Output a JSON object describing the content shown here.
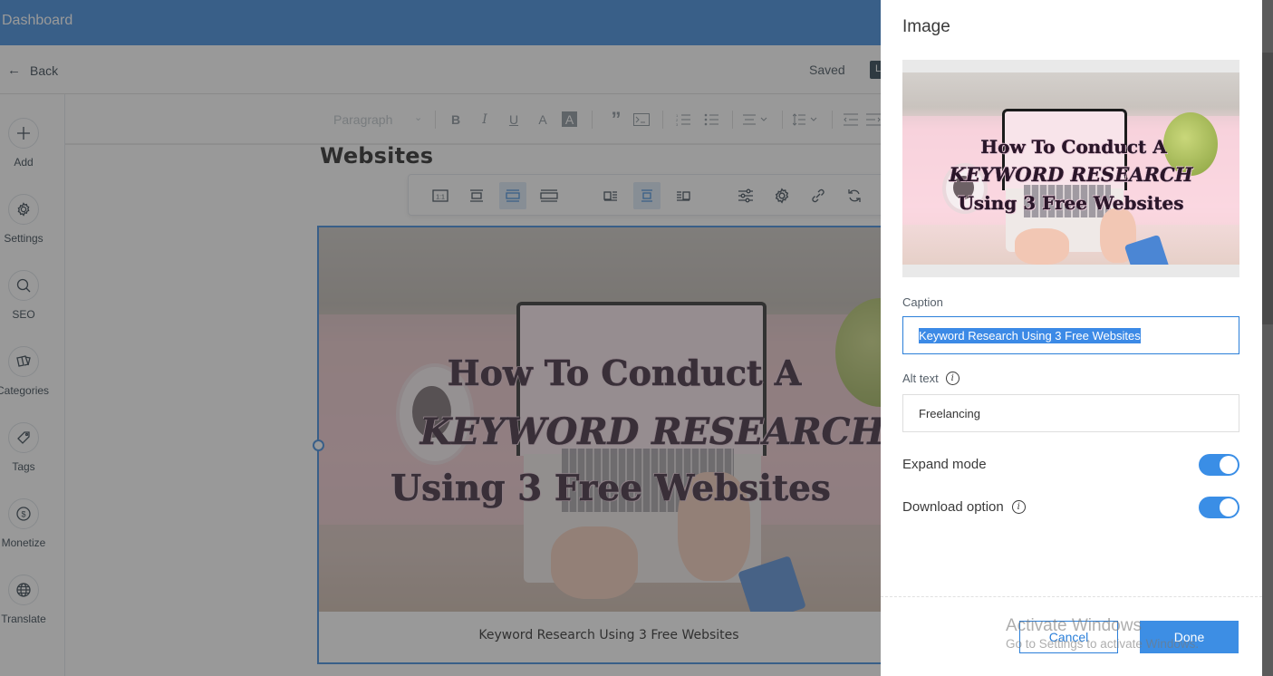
{
  "topbar": {
    "title": "Dashboard"
  },
  "subbar": {
    "back_label": "Back",
    "status": "Saved",
    "publish_stub": "L"
  },
  "sidebar": {
    "items": [
      {
        "label": "Add",
        "icon": "plus-icon"
      },
      {
        "label": "Settings",
        "icon": "gear-icon"
      },
      {
        "label": "SEO",
        "icon": "search-icon"
      },
      {
        "label": "Categories",
        "icon": "cards-icon"
      },
      {
        "label": "Tags",
        "icon": "tag-icon"
      },
      {
        "label": "Monetize",
        "icon": "dollar-icon"
      },
      {
        "label": "Translate",
        "icon": "globe-icon"
      }
    ]
  },
  "format_toolbar": {
    "paragraph_select": "Paragraph",
    "buttons": [
      "bold",
      "italic",
      "underline",
      "text-color",
      "highlight",
      "quote",
      "code-block",
      "numbered-list",
      "bulleted-list",
      "align",
      "line-spacing",
      "indent-decrease",
      "indent-increase"
    ],
    "labels": {
      "bold": "B",
      "italic": "I",
      "underline": "U",
      "quote": "”",
      "chevron": "⌄"
    }
  },
  "editor": {
    "heading": "Websites",
    "image_caption": "Keyword Research Using 3 Free Websites",
    "image_text": {
      "line1": "How To Conduct A",
      "line2": "KEYWORD RESEARCH",
      "line3": "Using 3 Free Websites"
    },
    "image_toolbar": {
      "buttons": [
        "original-size",
        "small",
        "best-fit",
        "full-width",
        "align-left",
        "align-center",
        "align-right",
        "settings-sliders",
        "gear",
        "link",
        "replace"
      ],
      "active": [
        "best-fit",
        "align-center"
      ],
      "ratio_label": "1:1"
    }
  },
  "panel": {
    "title": "Image",
    "caption_label": "Caption",
    "caption_value": "Keyword Research Using 3 Free Websites",
    "alt_label": "Alt text",
    "alt_value": "Freelancing",
    "expand_label": "Expand mode",
    "expand_on": true,
    "download_label": "Download option",
    "download_on": true,
    "cancel_label": "Cancel",
    "done_label": "Done"
  },
  "watermark": {
    "line1": "Activate Windows",
    "line2": "Go to Settings to activate Windows."
  },
  "colors": {
    "accent": "#2b7fd9",
    "toggle": "#3a8ee6",
    "done": "#3d8ee4",
    "selection": "#3c8ae6"
  }
}
